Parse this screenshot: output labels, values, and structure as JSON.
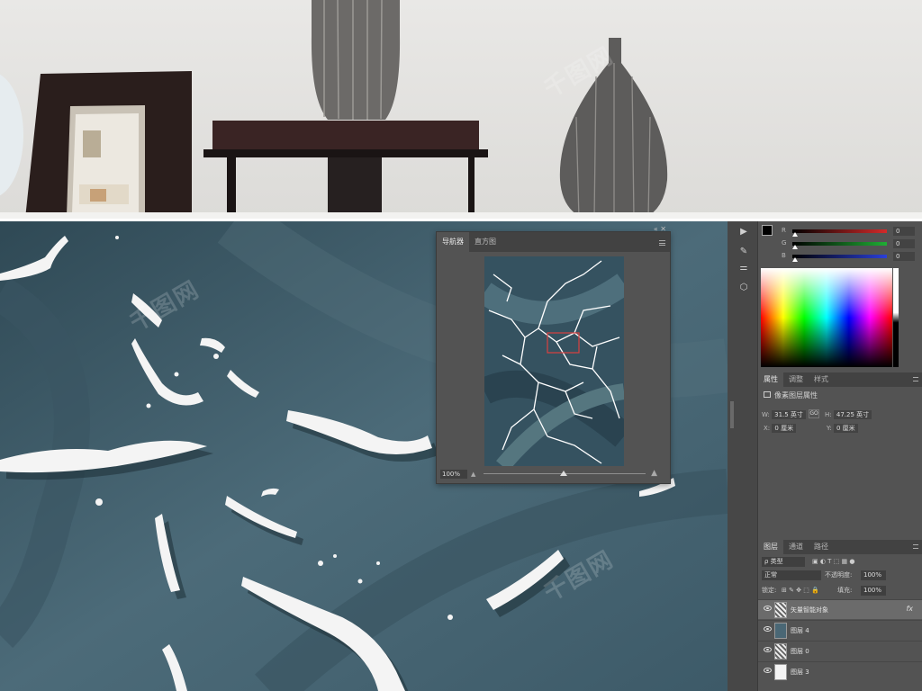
{
  "navigator": {
    "tabs": [
      "导航器",
      "直方图"
    ],
    "zoom": "100%",
    "zoom_percent": 100
  },
  "color": {
    "channels": [
      {
        "label": "R",
        "value": "0",
        "color": "#d32a2a"
      },
      {
        "label": "G",
        "value": "0",
        "color": "#1fae34"
      },
      {
        "label": "B",
        "value": "0",
        "color": "#2a3fd8"
      }
    ],
    "foreground": "#000000",
    "background": "#ffffff"
  },
  "properties": {
    "tabs": [
      "属性",
      "调整",
      "样式"
    ],
    "title": "像素图层属性",
    "w_label": "W:",
    "w_value": "31.5 英寸",
    "h_label": "H:",
    "h_value": "47.25 英寸",
    "x_label": "X:",
    "x_value": "0 厘米",
    "y_label": "Y:",
    "y_value": "0 厘米",
    "link_label": "GO"
  },
  "layers_panel": {
    "tabs": [
      "图层",
      "通道",
      "路径"
    ],
    "filter": "ρ 类型",
    "blend_mode": "正常",
    "opacity_label": "不透明度:",
    "opacity": "100%",
    "lock_label": "锁定:",
    "fill_label": "填充:",
    "fill": "100%",
    "layers": [
      {
        "name": "矢量智能对象",
        "fx": "fx",
        "active": true,
        "thumb": "pattern"
      },
      {
        "name": "图层 4",
        "fx": "",
        "active": false,
        "thumb": "teal"
      },
      {
        "name": "图层 0",
        "fx": "",
        "active": false,
        "thumb": "pattern"
      },
      {
        "name": "图层 3",
        "fx": "",
        "active": false,
        "thumb": "white"
      }
    ]
  },
  "colors": {
    "canvas_bg": "#4a6775",
    "panel_bg": "#535353",
    "crack_white": "#f4f4f4"
  }
}
